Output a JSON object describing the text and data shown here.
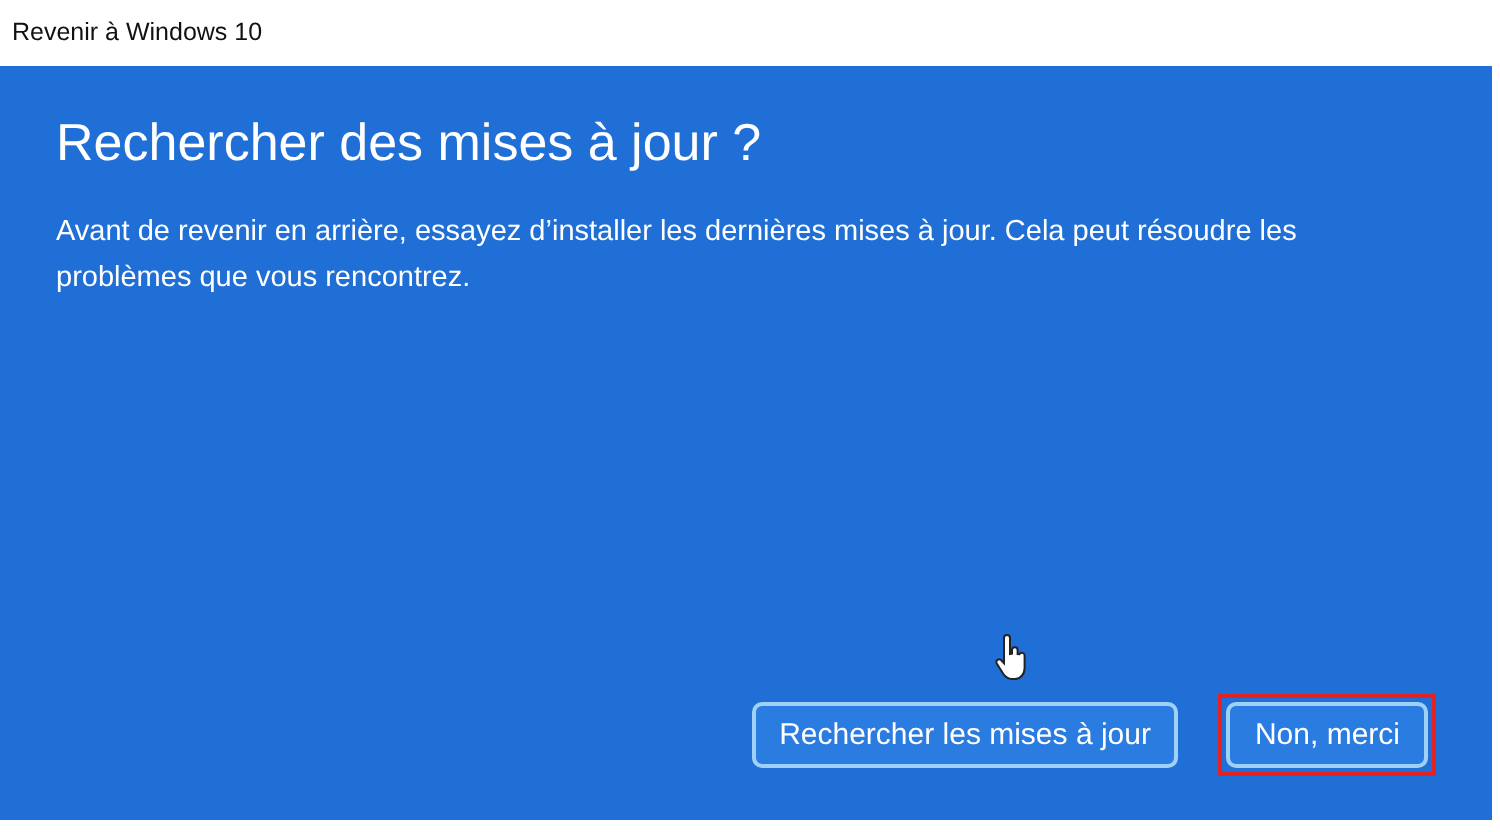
{
  "window": {
    "title": "Revenir à Windows 10"
  },
  "heading": "Rechercher des mises à jour ?",
  "description": "Avant de revenir en arrière, essayez d’installer les dernières mises à jour. Cela peut résoudre les problèmes que vous rencontrez.",
  "buttons": [
    {
      "label": "Rechercher les mises à jour",
      "highlighted": false
    },
    {
      "label": "Non, merci",
      "highlighted": true
    }
  ]
}
